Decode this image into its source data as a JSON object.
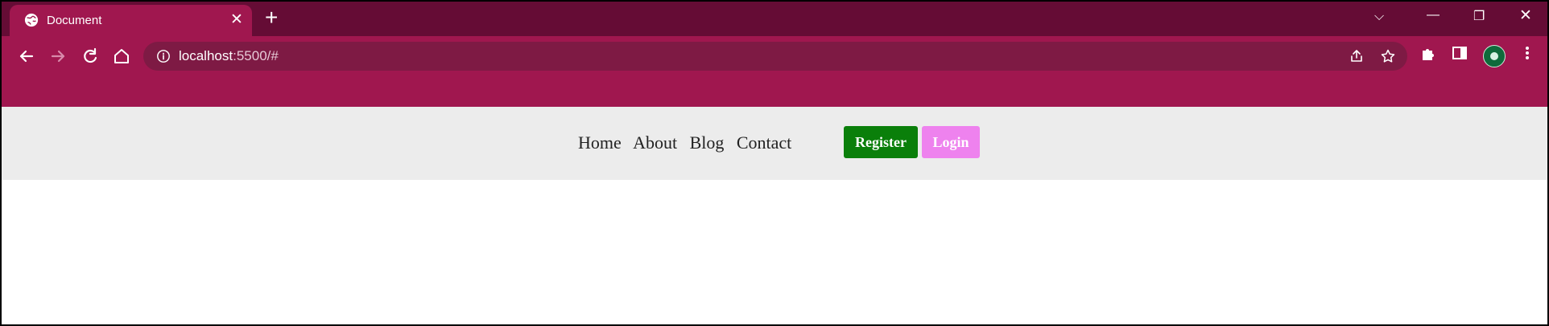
{
  "browser": {
    "tab": {
      "title": "Document"
    },
    "omnibox": {
      "host": "localhost",
      "rest": ":5500/#"
    }
  },
  "navbar": {
    "links": [
      "Home",
      "About",
      "Blog",
      "Contact"
    ],
    "register_label": "Register",
    "login_label": "Login"
  },
  "colors": {
    "tabstrip": "#650c35",
    "toolbar": "#a0174f",
    "omnibox": "#7e1a44",
    "navbar_bg": "#ececec",
    "register_bg": "#0a7f0a",
    "login_bg": "#ee82ee"
  },
  "icons": {
    "tab_favicon": "globe-icon",
    "back": "back-arrow-icon",
    "forward": "forward-arrow-icon",
    "reload": "reload-icon",
    "home": "home-icon",
    "site_info": "info-icon",
    "share": "share-icon",
    "bookmark": "star-icon",
    "extensions": "puzzle-icon",
    "side_panel": "side-panel-icon",
    "menu": "kebab-menu-icon"
  }
}
